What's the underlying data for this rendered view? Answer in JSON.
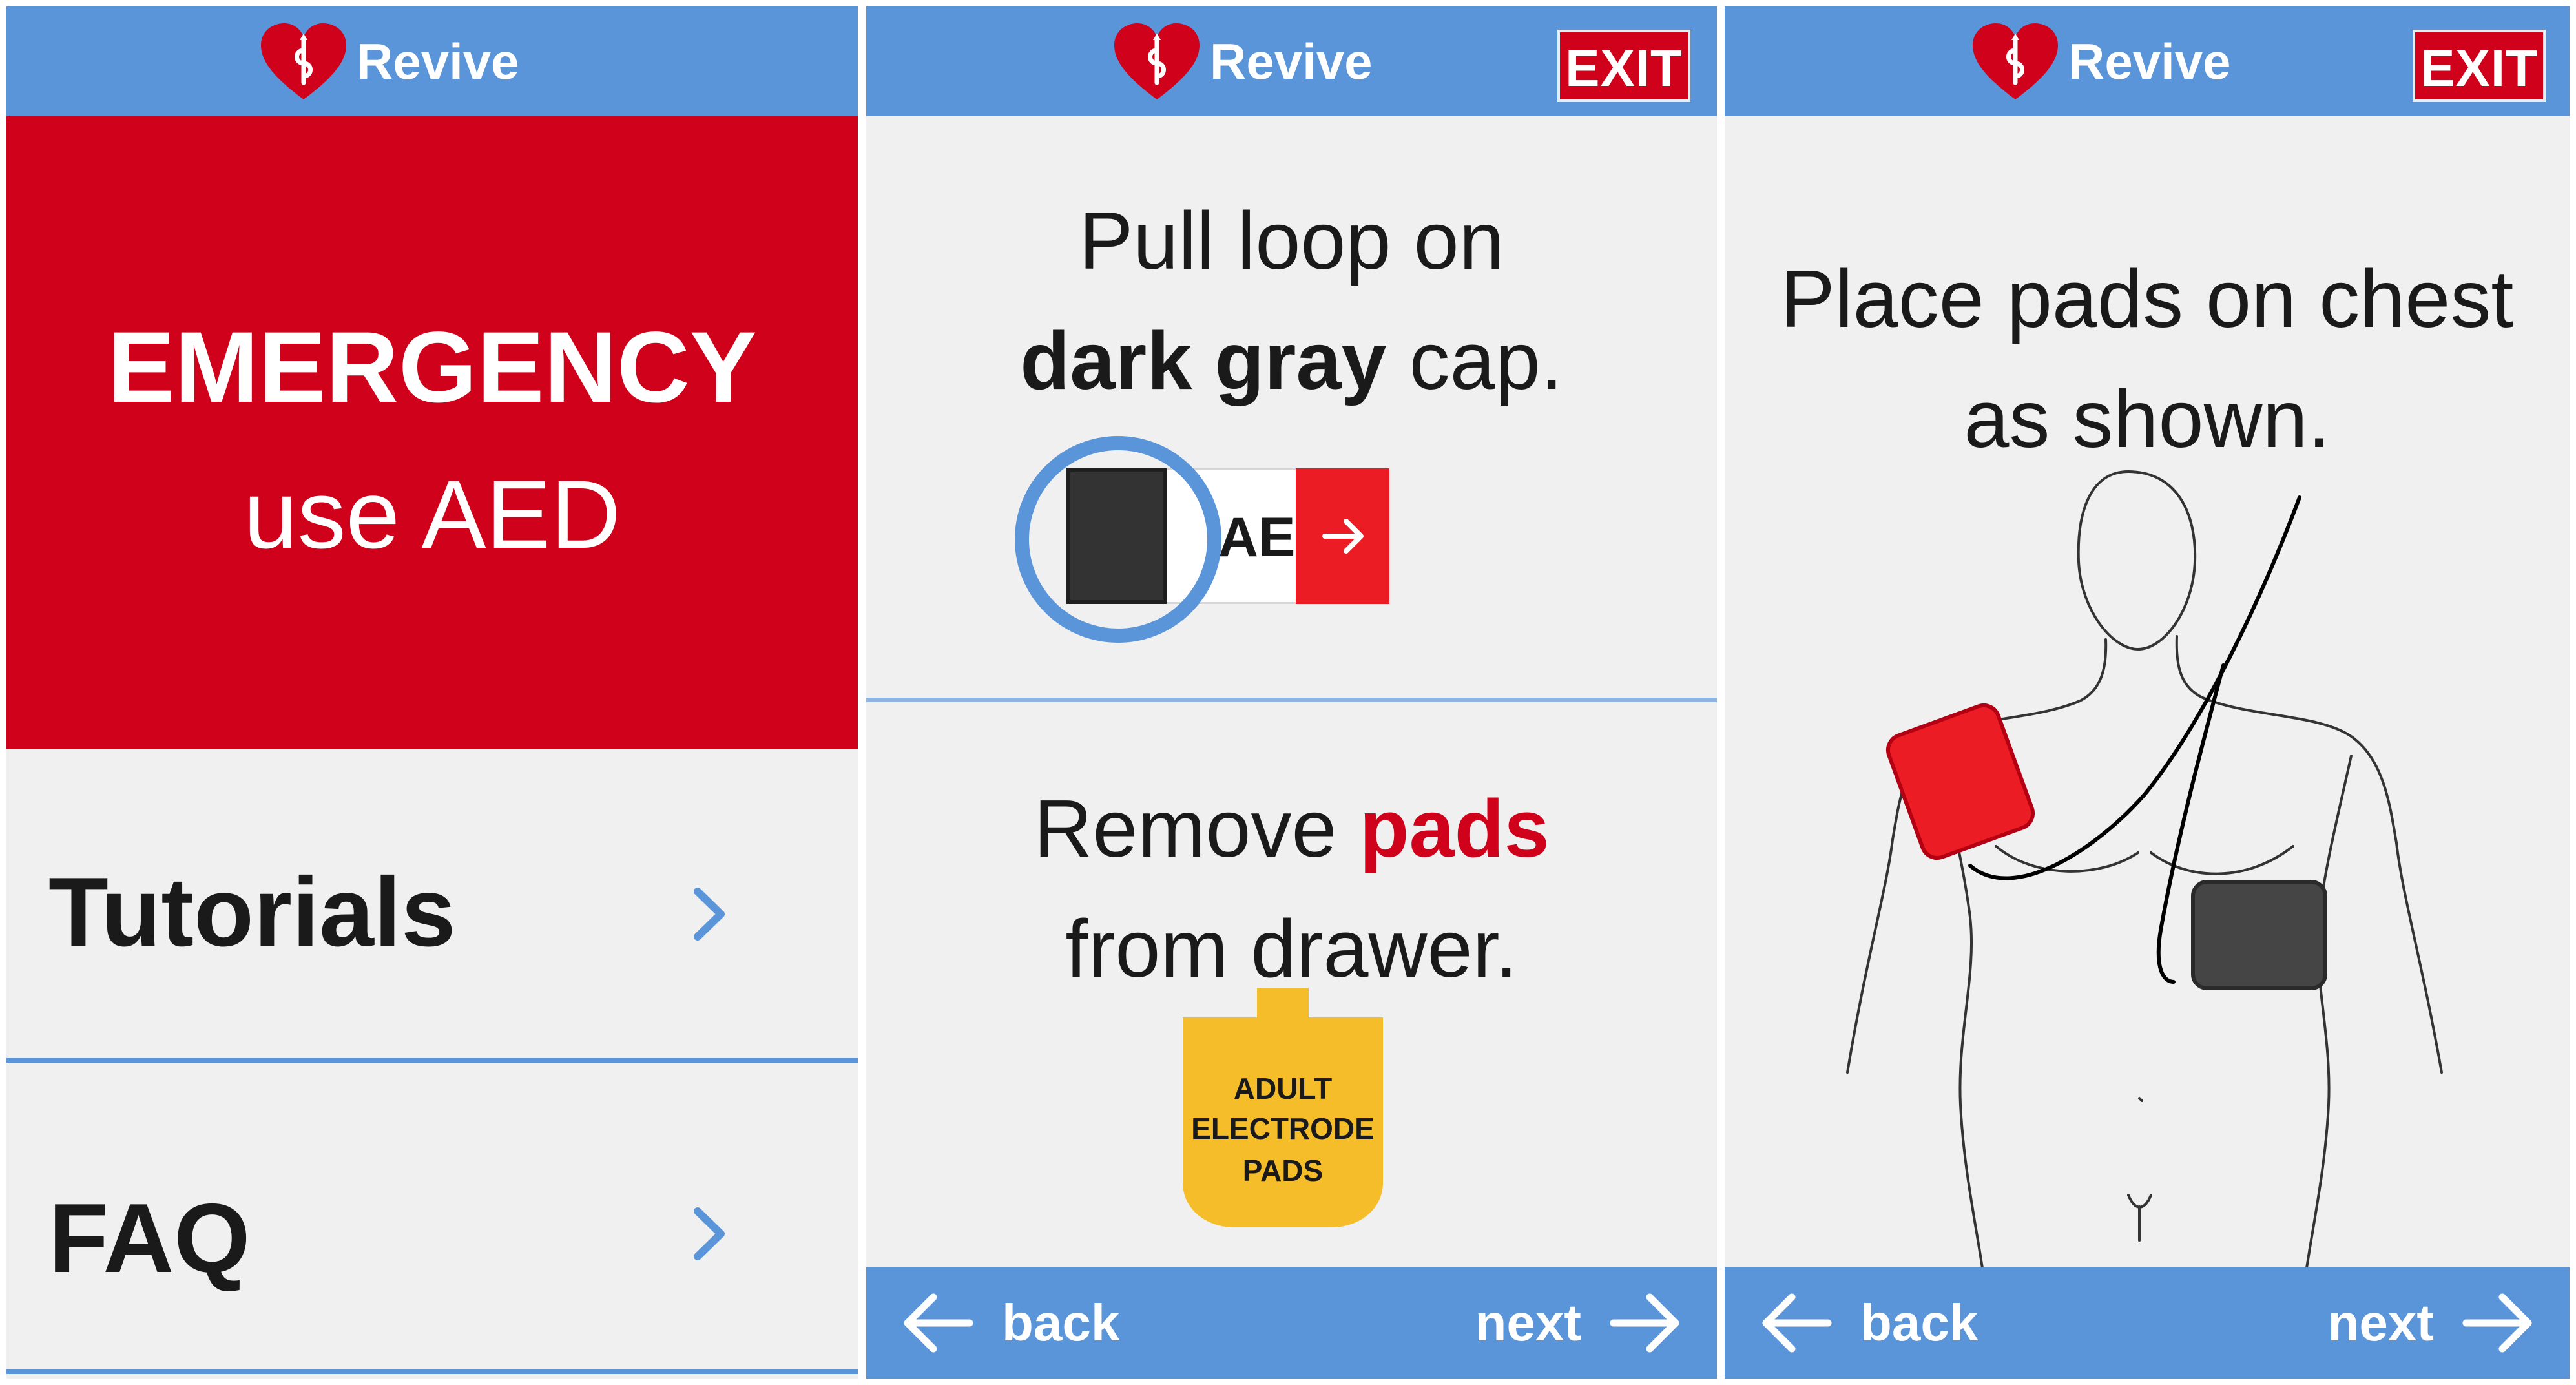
{
  "app": {
    "name": "Revive",
    "brand_color": "#5a95d9",
    "alert_color": "#d0021b"
  },
  "screen1": {
    "emergency": {
      "line1": "EMERGENCY",
      "line2": "use AED"
    },
    "menu": [
      {
        "label": "Tutorials",
        "icon": "chevron-right-icon"
      },
      {
        "label": "FAQ",
        "icon": "chevron-right-icon"
      }
    ]
  },
  "screen2": {
    "exit_label": "EXIT",
    "step1": {
      "line1": "Pull loop on",
      "bold": "dark gray",
      "rest": " cap."
    },
    "device_label": "AED",
    "step2": {
      "pre": "Remove ",
      "highlight": "pads",
      "line2": "from drawer."
    },
    "package": {
      "line1": "ADULT",
      "line2": "ELECTRODE",
      "line3": "PADS"
    },
    "nav": {
      "back": "back",
      "next": "next"
    }
  },
  "screen3": {
    "exit_label": "EXIT",
    "instruction": {
      "line1": "Place pads on chest",
      "line2": "as shown."
    },
    "nav": {
      "back": "back",
      "next": "next"
    }
  }
}
